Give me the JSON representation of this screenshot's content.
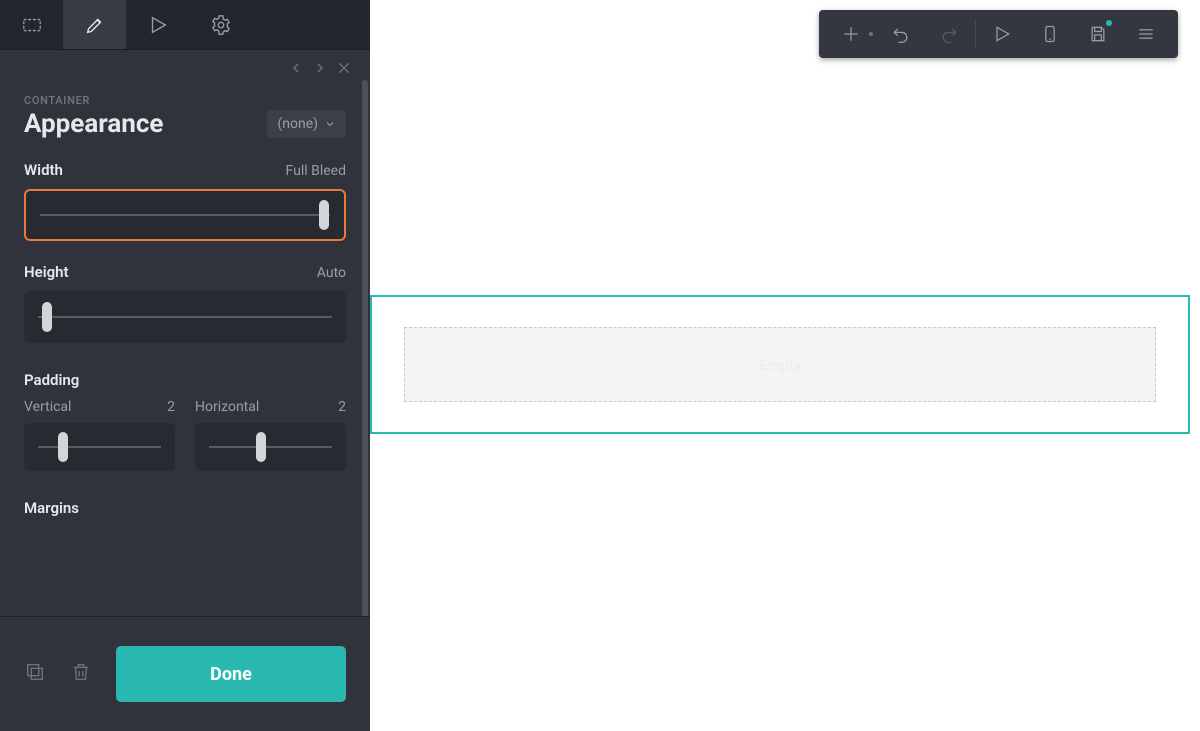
{
  "panel": {
    "eyebrow": "CONTAINER",
    "title": "Appearance",
    "selector_value": "(none)",
    "width": {
      "label": "Width",
      "value_label": "Full Bleed",
      "position_pct": 98
    },
    "height": {
      "label": "Height",
      "value_label": "Auto",
      "position_pct": 3
    },
    "padding": {
      "label": "Padding",
      "vertical": {
        "label": "Vertical",
        "value": "2",
        "position_pct": 20
      },
      "horizontal": {
        "label": "Horizontal",
        "value": "2",
        "position_pct": 42
      }
    },
    "margins": {
      "label": "Margins"
    },
    "done_label": "Done"
  },
  "canvas": {
    "empty_label": "Empty"
  }
}
